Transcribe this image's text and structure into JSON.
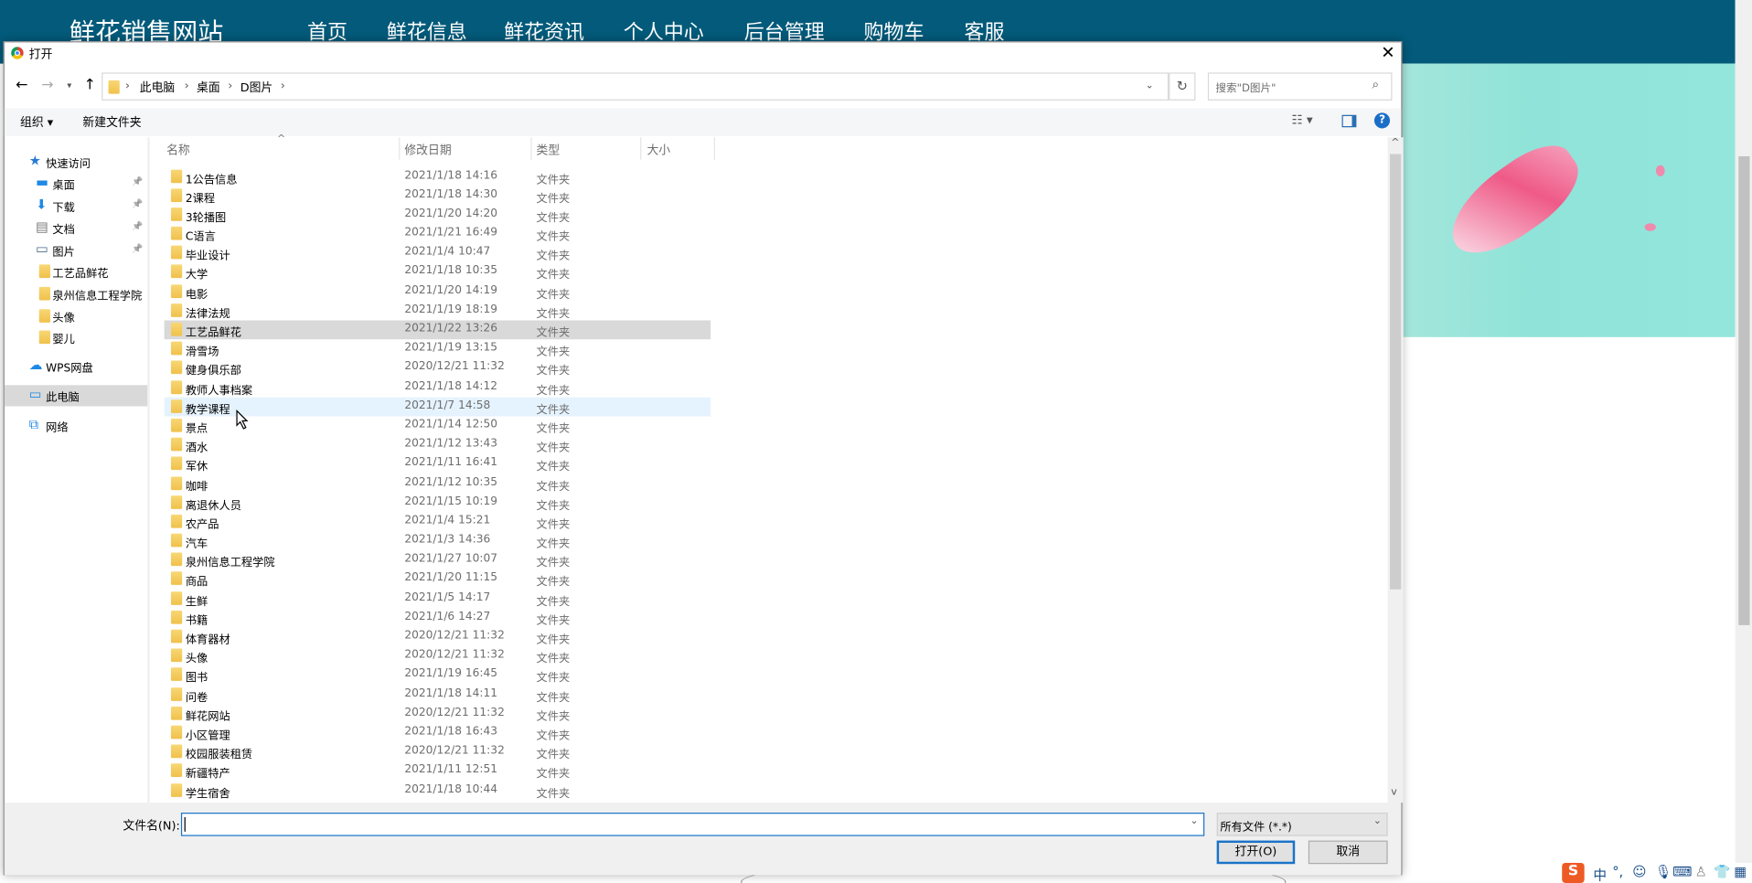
{
  "site": {
    "title": "鲜花销售网站",
    "nav": [
      "首页",
      "鲜花信息",
      "鲜花资讯",
      "个人中心",
      "后台管理",
      "购物车",
      "客服"
    ]
  },
  "dialog": {
    "title": "打开",
    "breadcrumb": [
      "此电脑",
      "桌面",
      "D图片"
    ],
    "search_placeholder": "搜索\"D图片\"",
    "toolbar": {
      "organize": "组织 ▾",
      "new_folder": "新建文件夹"
    },
    "sidebar": [
      {
        "label": "快速访问",
        "icon": "star-icon"
      },
      {
        "label": "桌面",
        "icon": "desktop-icon",
        "pinned": true
      },
      {
        "label": "下载",
        "icon": "download-icon",
        "pinned": true
      },
      {
        "label": "文档",
        "icon": "document-icon",
        "pinned": true
      },
      {
        "label": "图片",
        "icon": "picture-icon",
        "pinned": true
      },
      {
        "label": "工艺品鲜花",
        "icon": "folder-icon"
      },
      {
        "label": "泉州信息工程学院",
        "icon": "folder-icon"
      },
      {
        "label": "头像",
        "icon": "folder-icon"
      },
      {
        "label": "婴儿",
        "icon": "folder-icon"
      },
      {
        "label": "WPS网盘",
        "icon": "cloud-icon"
      },
      {
        "label": "此电脑",
        "icon": "computer-icon",
        "selected": true
      },
      {
        "label": "网络",
        "icon": "network-icon"
      }
    ],
    "columns": [
      "名称",
      "修改日期",
      "类型",
      "大小"
    ],
    "files": [
      [
        "1公告信息",
        "2021/1/18 14:16",
        "文件夹"
      ],
      [
        "2课程",
        "2021/1/18 14:30",
        "文件夹"
      ],
      [
        "3轮播图",
        "2021/1/20 14:20",
        "文件夹"
      ],
      [
        "C语言",
        "2021/1/21 16:49",
        "文件夹"
      ],
      [
        "毕业设计",
        "2021/1/4 10:47",
        "文件夹"
      ],
      [
        "大学",
        "2021/1/18 10:35",
        "文件夹"
      ],
      [
        "电影",
        "2021/1/20 14:19",
        "文件夹"
      ],
      [
        "法律法规",
        "2021/1/19 18:19",
        "文件夹"
      ],
      [
        "工艺品鲜花",
        "2021/1/22 13:26",
        "文件夹"
      ],
      [
        "滑雪场",
        "2021/1/19 13:15",
        "文件夹"
      ],
      [
        "健身俱乐部",
        "2020/12/21 11:32",
        "文件夹"
      ],
      [
        "教师人事档案",
        "2021/1/18 14:12",
        "文件夹"
      ],
      [
        "教学课程",
        "2021/1/7 14:58",
        "文件夹"
      ],
      [
        "景点",
        "2021/1/14 12:50",
        "文件夹"
      ],
      [
        "酒水",
        "2021/1/12 13:43",
        "文件夹"
      ],
      [
        "军休",
        "2021/1/11 16:41",
        "文件夹"
      ],
      [
        "咖啡",
        "2021/1/12 10:35",
        "文件夹"
      ],
      [
        "离退休人员",
        "2021/1/15 10:19",
        "文件夹"
      ],
      [
        "农产品",
        "2021/1/4 15:21",
        "文件夹"
      ],
      [
        "汽车",
        "2021/1/3 14:36",
        "文件夹"
      ],
      [
        "泉州信息工程学院",
        "2021/1/27 10:07",
        "文件夹"
      ],
      [
        "商品",
        "2021/1/20 11:15",
        "文件夹"
      ],
      [
        "生鲜",
        "2021/1/5 14:17",
        "文件夹"
      ],
      [
        "书籍",
        "2021/1/6 14:27",
        "文件夹"
      ],
      [
        "体育器材",
        "2020/12/21 11:32",
        "文件夹"
      ],
      [
        "头像",
        "2020/12/21 11:32",
        "文件夹"
      ],
      [
        "图书",
        "2021/1/19 16:45",
        "文件夹"
      ],
      [
        "问卷",
        "2021/1/18 14:11",
        "文件夹"
      ],
      [
        "鲜花网站",
        "2020/12/21 11:32",
        "文件夹"
      ],
      [
        "小区管理",
        "2021/1/18 16:43",
        "文件夹"
      ],
      [
        "校园服装租赁",
        "2020/12/21 11:32",
        "文件夹"
      ],
      [
        "新疆特产",
        "2021/1/11 12:51",
        "文件夹"
      ],
      [
        "学生宿舍",
        "2021/1/18 10:44",
        "文件夹"
      ]
    ],
    "selected_index": 8,
    "hover_index": 12,
    "filename_label": "文件名(N):",
    "filename_value": "",
    "filetype": "所有文件 (*.*)",
    "open_button": "打开(O)",
    "cancel_button": "取消"
  },
  "ime": {
    "lang": "中"
  }
}
